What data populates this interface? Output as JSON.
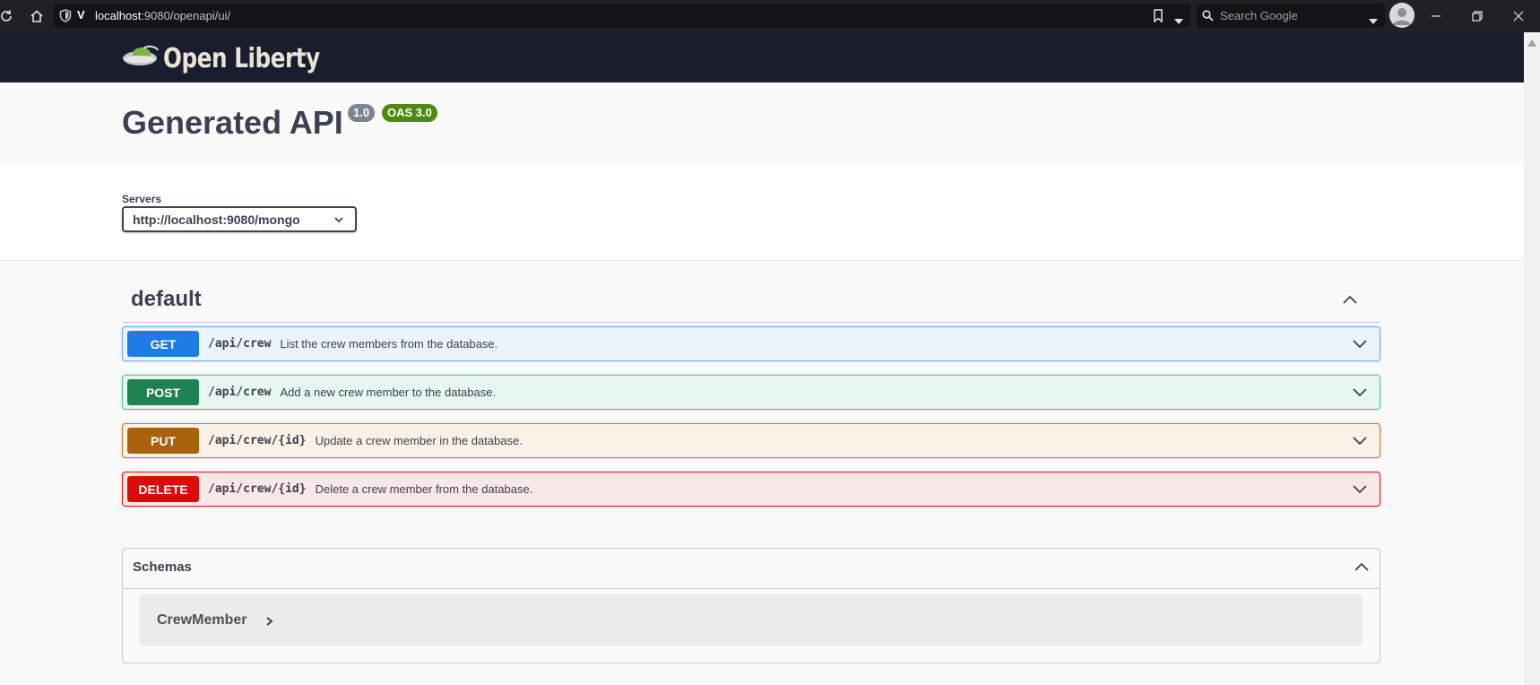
{
  "browser": {
    "url_host": "localhost",
    "url_rest": ":9080/openapi/ui/",
    "search_placeholder": "Search Google"
  },
  "header": {
    "logo_text": "Open Liberty"
  },
  "info": {
    "title": "Generated API",
    "version_badge": "1.0",
    "oas_badge": "OAS 3.0"
  },
  "servers": {
    "label": "Servers",
    "selected": "http://localhost:9080/mongo"
  },
  "tag": {
    "name": "default"
  },
  "operations": [
    {
      "method": "GET",
      "path": "/api/crew",
      "summary": "List the crew members from the database."
    },
    {
      "method": "POST",
      "path": "/api/crew",
      "summary": "Add a new crew member to the database."
    },
    {
      "method": "PUT",
      "path": "/api/crew/{id}",
      "summary": "Update a crew member in the database."
    },
    {
      "method": "DELETE",
      "path": "/api/crew/{id}",
      "summary": "Delete a crew member from the database."
    }
  ],
  "schemas": {
    "title": "Schemas",
    "models": [
      "CrewMember"
    ]
  },
  "colors": {
    "get": "#1f7be5",
    "post": "#208153",
    "put": "#a8620b",
    "delete": "#dc0b0b",
    "header_bg": "#191d2e"
  }
}
